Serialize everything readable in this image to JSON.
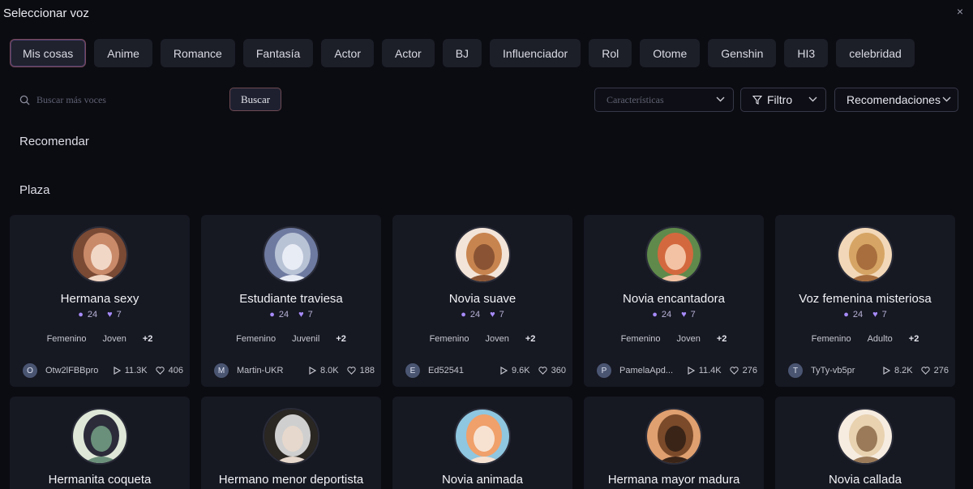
{
  "window": {
    "title": "Seleccionar voz",
    "close": "×"
  },
  "tabs": [
    {
      "label": "Mis cosas",
      "active": true
    },
    {
      "label": "Anime"
    },
    {
      "label": "Romance"
    },
    {
      "label": "Fantasía"
    },
    {
      "label": "Actor"
    },
    {
      "label": "Actor"
    },
    {
      "label": "BJ"
    },
    {
      "label": "Influenciador"
    },
    {
      "label": "Rol"
    },
    {
      "label": "Otome"
    },
    {
      "label": "Genshin"
    },
    {
      "label": "HI3"
    },
    {
      "label": "celebridad"
    }
  ],
  "search": {
    "placeholder": "Buscar más voces",
    "button": "Buscar"
  },
  "filters": {
    "characteristics": "Características",
    "filter": "Filtro",
    "sort": "Recomendaciones"
  },
  "sections": {
    "recommend": "Recomendar",
    "plaza": "Plaza"
  },
  "cards": [
    {
      "name": "Hermana sexy",
      "s1": "24",
      "s2": "7",
      "tags": [
        "Femenino",
        "Joven"
      ],
      "more": "+2",
      "user_initial": "O",
      "user": "Otw2lFBBpro",
      "plays": "11.3K",
      "likes": "406",
      "av": [
        "#c98a6a",
        "#7a4a35",
        "#f1d7c6"
      ]
    },
    {
      "name": "Estudiante traviesa",
      "s1": "24",
      "s2": "7",
      "tags": [
        "Femenino",
        "Juvenil"
      ],
      "more": "+2",
      "user_initial": "M",
      "user": "Martin-UKR",
      "plays": "8.0K",
      "likes": "188",
      "av": [
        "#b9c3d6",
        "#6e7aa0",
        "#e8ecf5"
      ]
    },
    {
      "name": "Novia suave",
      "s1": "24",
      "s2": "7",
      "tags": [
        "Femenino",
        "Joven"
      ],
      "more": "+2",
      "user_initial": "E",
      "user": "Ed52541",
      "plays": "9.6K",
      "likes": "360",
      "av": [
        "#c8844f",
        "#f2e4d8",
        "#8a5434"
      ]
    },
    {
      "name": "Novia encantadora",
      "s1": "24",
      "s2": "7",
      "tags": [
        "Femenino",
        "Joven"
      ],
      "more": "+2",
      "user_initial": "P",
      "user": "PamelaApd...",
      "plays": "11.4K",
      "likes": "276",
      "av": [
        "#d3683e",
        "#5f8a4c",
        "#f3c2a4"
      ]
    },
    {
      "name": "Voz femenina misteriosa",
      "s1": "24",
      "s2": "7",
      "tags": [
        "Femenino",
        "Adulto"
      ],
      "more": "+2",
      "user_initial": "T",
      "user": "TyTy-vb5pr",
      "plays": "8.2K",
      "likes": "276",
      "av": [
        "#d6a565",
        "#f2d8b8",
        "#a86e3e"
      ]
    },
    {
      "name": "Hermanita coqueta",
      "av": [
        "#2b2b3a",
        "#dfe8d8",
        "#6a8f7a"
      ]
    },
    {
      "name": "Hermano menor deportista",
      "av": [
        "#cfcfcf",
        "#2a2622",
        "#e6d8cc"
      ]
    },
    {
      "name": "Novia animada",
      "av": [
        "#f0a06a",
        "#8fc6e0",
        "#f7e2d2"
      ]
    },
    {
      "name": "Hermana mayor madura",
      "av": [
        "#7a4a2a",
        "#e0a070",
        "#3a2418"
      ]
    },
    {
      "name": "Novia callada",
      "av": [
        "#e8d2b0",
        "#f6ece0",
        "#9a7a58"
      ]
    }
  ]
}
